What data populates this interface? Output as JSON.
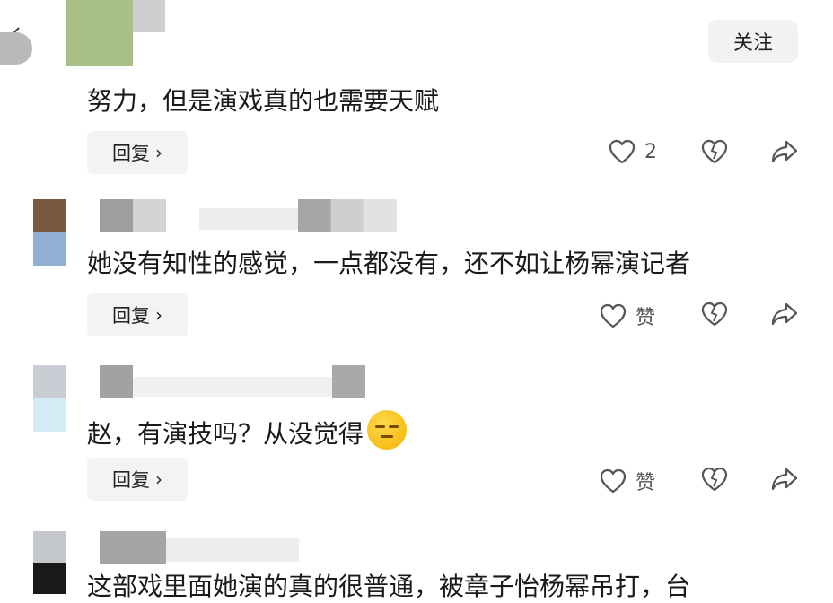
{
  "header": {
    "follow_label": "关注"
  },
  "comments": [
    {
      "text": "努力，但是演戏真的也需要天赋",
      "reply_label": "回复",
      "like_label": "2"
    },
    {
      "text": "她没有知性的感觉，一点都没有，还不如让杨幂演记者",
      "reply_label": "回复",
      "like_label": "赞"
    },
    {
      "text": "赵，有演技吗？从没觉得",
      "reply_label": "回复",
      "like_label": "赞"
    },
    {
      "text": "这部戏里面她演的真的很普通，被章子怡杨幂吊打，台"
    }
  ],
  "icons": {
    "back": "chevron-left-icon",
    "like": "heart-icon",
    "dislike": "broken-heart-icon",
    "share": "share-arrow-icon",
    "emoji": "smirk-emoji"
  }
}
